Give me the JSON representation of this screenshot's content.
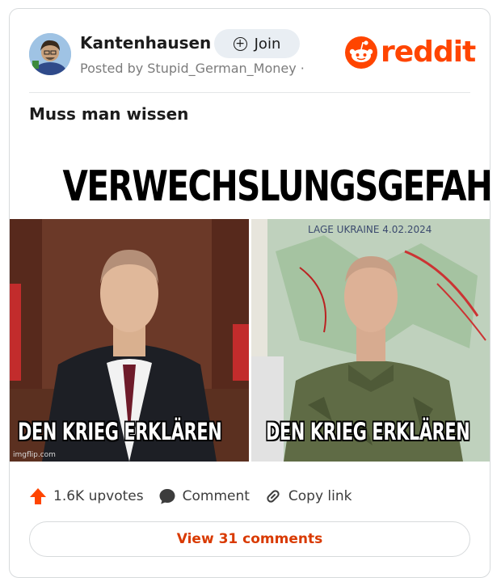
{
  "subreddit": {
    "name": "Kantenhausen",
    "join_label": "Join",
    "posted_by": "Posted by Stupid_German_Money ·"
  },
  "brand": {
    "wordmark": "reddit",
    "color": "#ff4500"
  },
  "post": {
    "title": "Muss man wissen",
    "image": {
      "headline": "VERWECHSLUNGSGEFAHR",
      "left_caption": "DEN KRIEG ERKLÄREN",
      "right_caption": "DEN KRIEG ERKLÄREN",
      "map_label": "LAGE UKRAINE 4.02.2024",
      "watermark": "imgflip.com"
    }
  },
  "actions": {
    "upvotes": "1.6K upvotes",
    "comment": "Comment",
    "copy_link": "Copy link"
  },
  "comments_button": "View 31 comments",
  "icons": [
    "plus-circle-icon",
    "reddit-snoo-icon",
    "upvote-arrow-icon",
    "comment-bubble-icon",
    "link-icon"
  ]
}
